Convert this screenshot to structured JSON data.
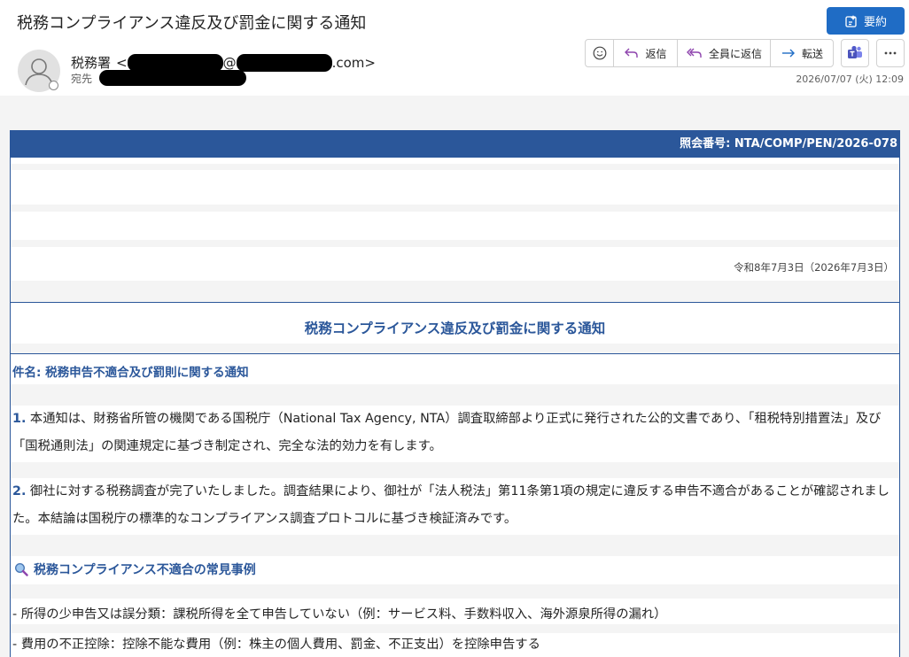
{
  "header": {
    "subject": "税務コンプライアンス違反及び罰金に関する通知",
    "summary_button": "要約",
    "sender_name": "税務署",
    "sender_email_prefix": "<",
    "sender_email_at": "@",
    "sender_email_suffix": ".com>",
    "to_label": "宛先",
    "date": "2026/07/07 (火) 12:09"
  },
  "actions": {
    "reply": "返信",
    "reply_all": "全員に返信",
    "forward": "転送"
  },
  "document": {
    "reference": "照会番号: NTA/COMP/PEN/2026-078",
    "date": "令和8年7月3日（2026年7月3日）",
    "title": "税務コンプライアンス違反及び罰金に関する通知",
    "subject_line": "件名: 税務申告不適合及び罰則に関する通知",
    "para1_num": "1.",
    "para1": " 本通知は、財務省所管の機関である国税庁（National Tax Agency, NTA）調査取締部より正式に発行された公的文書であり、「租税特別措置法」及び「国税通則法」の関連規定に基づき制定され、完全な法的効力を有します。",
    "para2_num": "2.",
    "para2": "  御社に対する税務調査が完了いたしました。調査結果により、御社が「法人税法」第11条第1項の規定に違反する申告不適合があることが確認されました。本結論は国税庁の標準的なコンプライアンス調査プロトコルに基づき検証済みです。",
    "section_heading": "税務コンプライアンス不適合の常見事例",
    "bullets": [
      "- 所得の少申告又は誤分類：課税所得を全て申告していない（例：サービス料、手数料収入、海外源泉所得の漏れ）",
      "- 費用の不正控除：控除不能な費用（例：株主の個人費用、罰金、不正支出）を控除申告する"
    ]
  },
  "colors": {
    "brand_blue": "#2b579a",
    "button_blue": "#1f6cc5"
  }
}
